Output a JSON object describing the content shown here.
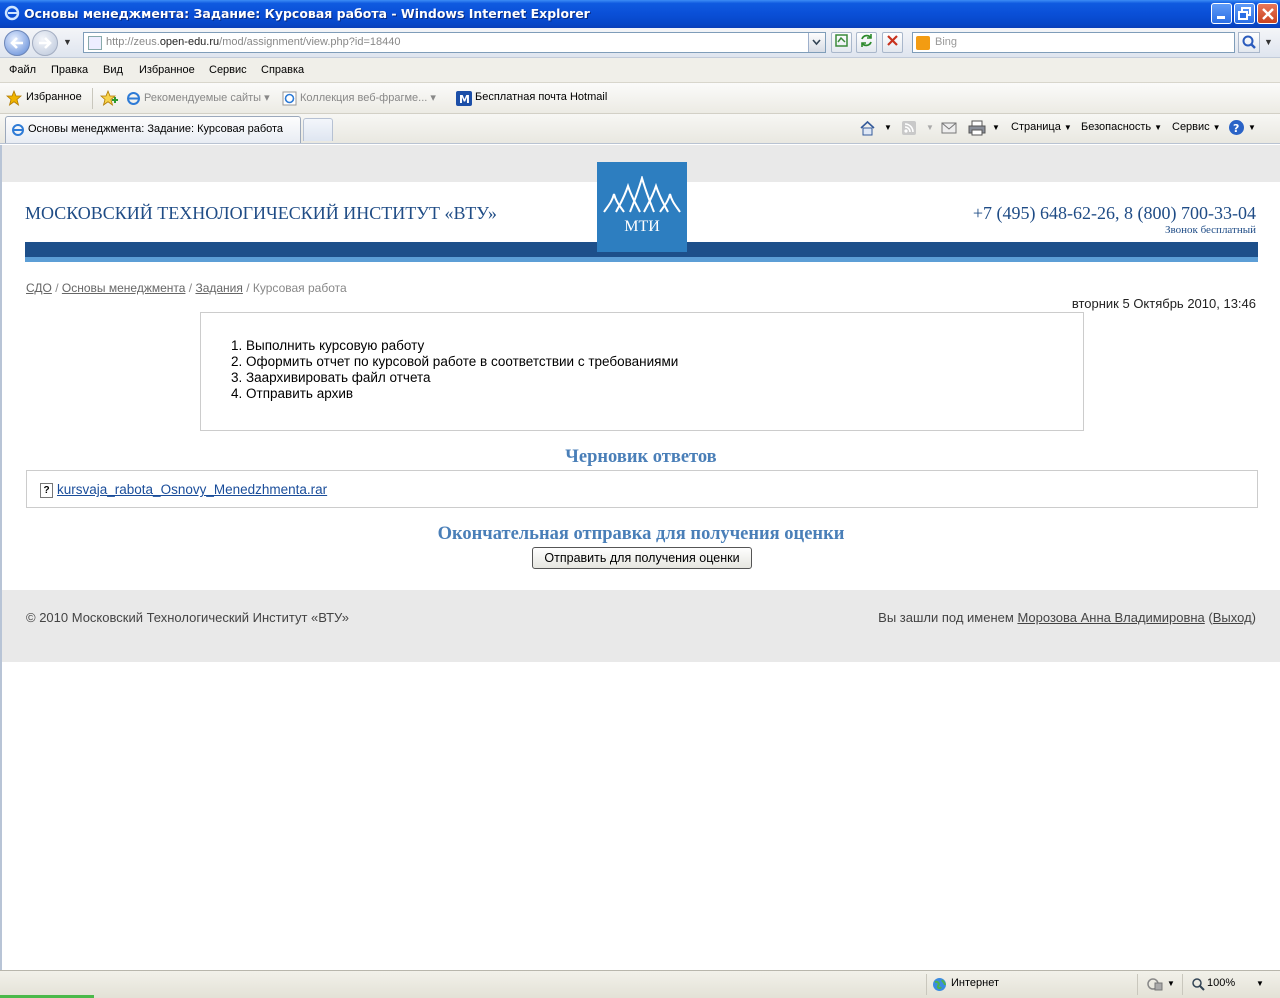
{
  "window": {
    "title": "Основы менеджмента: Задание: Курсовая работа - Windows Internet Explorer"
  },
  "address": {
    "url_prefix": "http://zeus.",
    "url_host": "open-edu.ru",
    "url_path": "/mod/assignment/view.php?id=18440",
    "search_placeholder": "Bing"
  },
  "menu": [
    "Файл",
    "Правка",
    "Вид",
    "Избранное",
    "Сервис",
    "Справка"
  ],
  "favorites": {
    "label": "Избранное",
    "items": [
      "Рекомендуемые сайты ▾",
      "Коллекция веб-фрагме... ▾",
      "Бесплатная почта Hotmail"
    ]
  },
  "tab": {
    "title": "Основы менеджмента: Задание: Курсовая работа"
  },
  "commands": {
    "page": "Страница",
    "safety": "Безопасность",
    "tools": "Сервис"
  },
  "site": {
    "institute_name": "МОСКОВСКИЙ ТЕХНОЛОГИЧЕСКИЙ ИНСТИТУТ «ВТУ»",
    "logo_text": "МТИ",
    "phones": "+7 (495) 648-62-26,  8 (800) 700-33-04",
    "free_call": "Звонок бесплатный"
  },
  "breadcrumb": {
    "items": [
      "СДО",
      "Основы менеджмента",
      "Задания"
    ],
    "current": "Курсовая работа"
  },
  "datetime": "вторник 5 Октябрь 2010, 13:46",
  "task_steps": [
    "1.  Выполнить курсовую работу",
    "2.  Оформить отчет по курсовой работе в соответствии с требованиями",
    "3.  Заархивировать файл отчета",
    "4.  Отправить архив"
  ],
  "draft": {
    "title": "Черновик ответов",
    "file_name": "kursvaja_rabota_Osnovy_Menedzhmenta.rar"
  },
  "final": {
    "title": "Окончательная отправка для получения оценки",
    "button": "Отправить для получения оценки"
  },
  "footer": {
    "copyright": "© 2010 Московский Технологический Институт «ВТУ»",
    "login_prefix": "Вы зашли под именем ",
    "user_name": "Морозова Анна Владимировна",
    "logout": "Выход"
  },
  "status": {
    "zone": "Интернет",
    "zoom": "100%"
  }
}
